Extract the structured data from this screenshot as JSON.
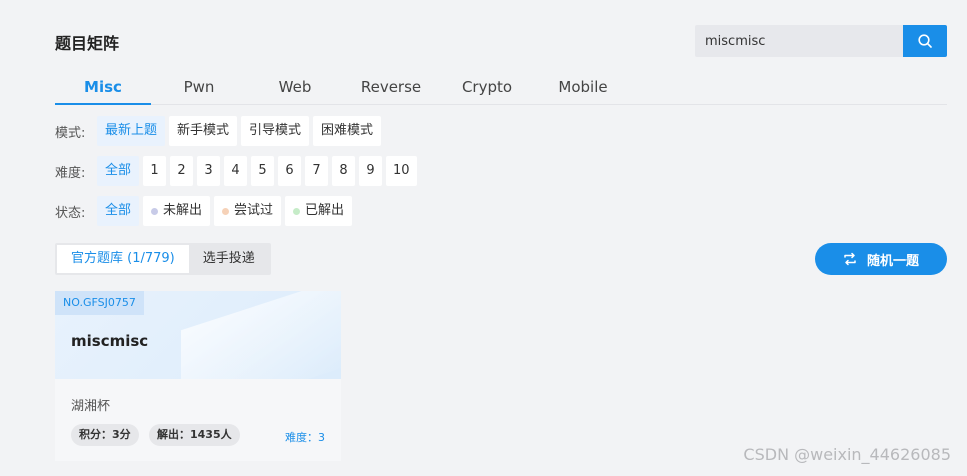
{
  "page_title": "题目矩阵",
  "search": {
    "value": "miscmisc",
    "icon": "search-icon"
  },
  "tabs": [
    "Misc",
    "Pwn",
    "Web",
    "Reverse",
    "Crypto",
    "Mobile"
  ],
  "filters": {
    "mode": {
      "label": "模式:",
      "options": [
        "最新上题",
        "新手模式",
        "引导模式",
        "困难模式"
      ]
    },
    "difficulty": {
      "label": "难度:",
      "options": [
        "全部",
        "1",
        "2",
        "3",
        "4",
        "5",
        "6",
        "7",
        "8",
        "9",
        "10"
      ]
    },
    "status": {
      "label": "状态:",
      "options": [
        {
          "label": "全部"
        },
        {
          "label": "未解出",
          "dot_color": "#c8cbe8"
        },
        {
          "label": "尝试过",
          "dot_color": "#f6d2b8"
        },
        {
          "label": "已解出",
          "dot_color": "#c6ecc8"
        }
      ]
    }
  },
  "source_tabs": [
    "官方题库 (1/779)",
    "选手投递"
  ],
  "random_button": {
    "label": "随机一题",
    "icon": "shuffle-icon"
  },
  "card": {
    "number": "NO.GFSJ0757",
    "name": "miscmisc",
    "event": "湖湘杯",
    "points": "积分：3分",
    "solves": "解出：1435人",
    "difficulty": "难度：3"
  },
  "watermark": "CSDN @weixin_44626085",
  "colors": {
    "accent": "#1a8ee8",
    "background": "#f2f3f5"
  }
}
